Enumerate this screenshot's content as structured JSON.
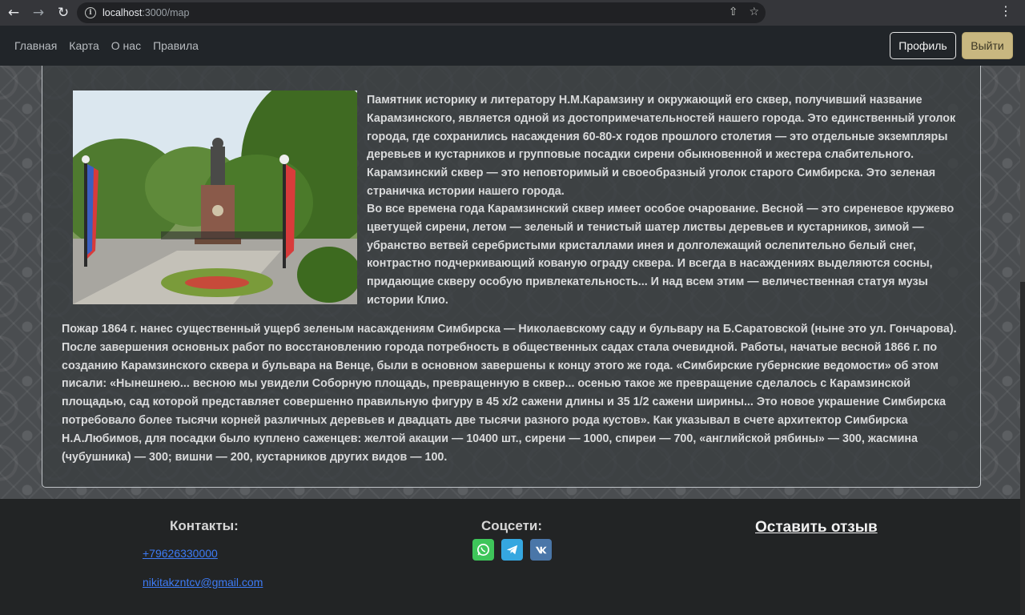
{
  "browser": {
    "url_host": "localhost",
    "url_path": ":3000/map"
  },
  "navbar": {
    "links": [
      "Главная",
      "Карта",
      "О нас",
      "Правила"
    ],
    "profile_label": "Профиль",
    "logout_label": "Выйти"
  },
  "main": {
    "paragraph_1": "Памятник историку и литератору Н.М.Карамзину и окружающий его сквер, получивший название Карамзинского, является одной из достопримечательностей нашего города. Это единственный уголок города, где сохранились насаждения 60-80-х годов прошлого столетия — это отдельные экземпляры деревьев и кустарников и групповые посадки сирени обыкновенной и жестера слабительного. Карамзинский сквер — это неповторимый и своеобразный уголок старого Симбирска. Это зеленая страничка истории нашего города.",
    "paragraph_2": "Во все времена года Карамзинский сквер имеет особое очарование. Весной — это сиреневое кружево цветущей сирени, летом — зеленый и тенистый шатер листвы деревьев и кустарников, зимой — убранство ветвей серебристыми кристаллами инея и долголежащий ослепительно белый снег, контрастно подчеркивающий кованую ограду сквера. И всегда в насаждениях выделяются сосны, придающие скверу особую привлекательность... И над всем этим — величественная статуя музы истории Клио.",
    "paragraph_3": "Пожар 1864 г. нанес существенный ущерб зеленым насаждениям Симбирска — Николаевскому саду и бульвару на Б.Саратовской (ныне это ул. Гончарова). После завершения основных работ по восстановлению города потребность в общественных садах стала очевидной. Работы, начатые весной 1866 г. по созданию Карамзинского сквера и бульвара на Венце, были в основном завершены к концу этого же года. «Симбирские губернские ведомости» об этом писали: «Нынешнею... весною мы увидели Соборную площадь, превращенную в сквер... осенью такое же превращение сделалось с Карамзинской площадью, сад которой представляет совершенно правильную фигуру в 45 х/2 сажени длины и 35 1/2 сажени ширины... Это новое украшение Симбирска потребовало более тысячи корней различных деревьев и двадцать две тысячи разного рода кустов». Как указывал в счете архитектор Симбирска Н.А.Любимов, для посадки было куплено саженцев: желтой акации — 10400 шт., сирени — 1000, спиреи — 700, «английской рябины» — 300, жасмина (чубушника) — 300; вишни — 200, кустарников других видов — 100."
  },
  "footer": {
    "contacts_title": "Контакты:",
    "phone": "+79626330000",
    "email": "nikitakzntcv@gmail.com",
    "social_title": "Соцсети:",
    "social_icons": [
      "whatsapp-icon",
      "telegram-icon",
      "vk-icon"
    ],
    "review_link": "Оставить отзыв"
  },
  "colors": {
    "navbar_bg": "#212529",
    "logout_btn": "#c8b780",
    "link": "#3d7bf5",
    "footer_bg": "#222425"
  }
}
